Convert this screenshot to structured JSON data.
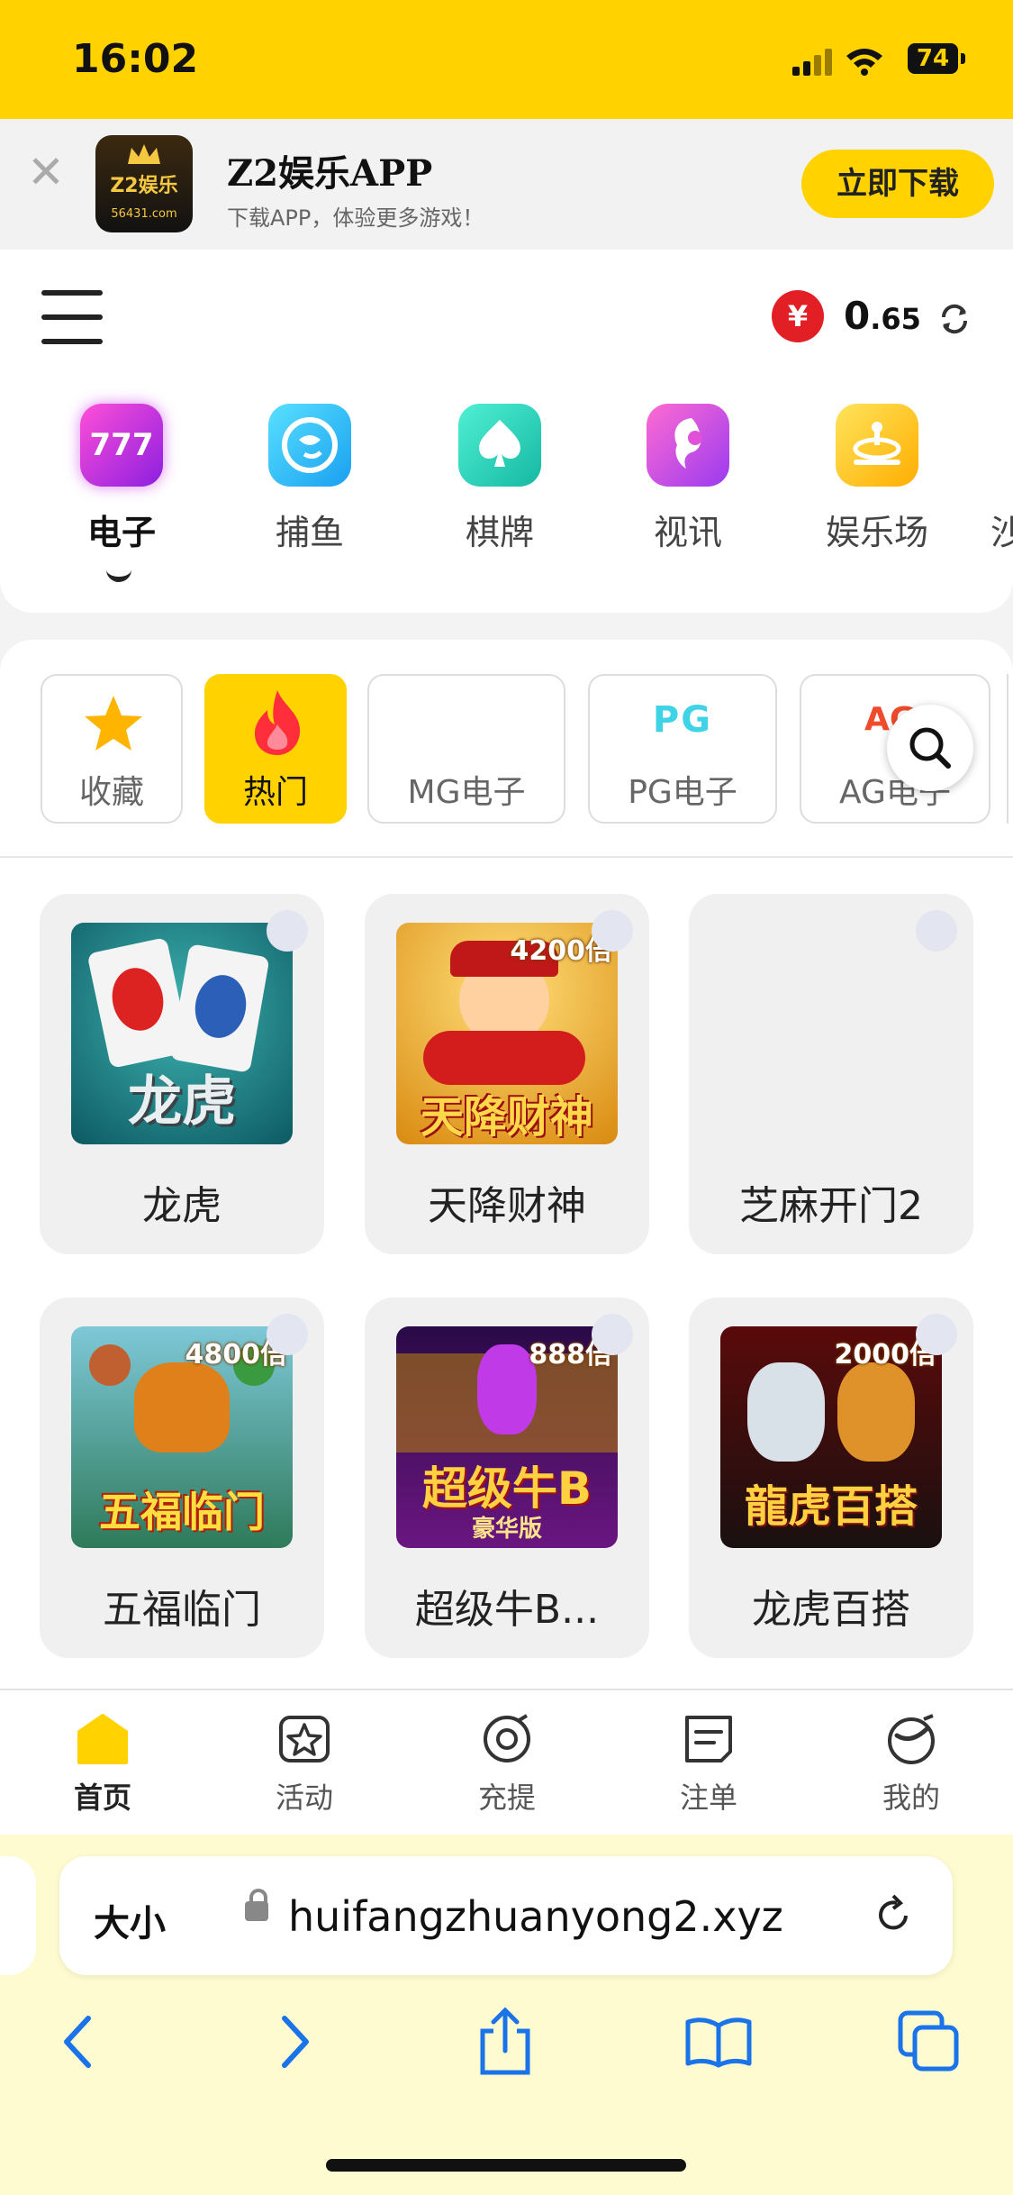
{
  "status": {
    "time": "16:02",
    "battery": "74"
  },
  "banner": {
    "app_name": "Z2娱乐APP",
    "subtitle": "下载APP，体验更多游戏！",
    "button": "立即下载",
    "logo_text": "Z2娱乐",
    "logo_url": "56431.com"
  },
  "header": {
    "currency_symbol": "¥",
    "balance_main": "0",
    "balance_decimal": ".65"
  },
  "categories": [
    {
      "label": "电子",
      "icon": "777-icon",
      "active": true
    },
    {
      "label": "捕鱼",
      "icon": "fish-icon"
    },
    {
      "label": "棋牌",
      "icon": "spade-icon"
    },
    {
      "label": "视讯",
      "icon": "live-woman-icon"
    },
    {
      "label": "娱乐场",
      "icon": "casino-icon"
    },
    {
      "label": "沙",
      "icon": "partial-icon"
    }
  ],
  "filters": [
    {
      "label": "收藏",
      "icon": "star-icon"
    },
    {
      "label": "热门",
      "icon": "fire-icon",
      "active": true
    },
    {
      "label": "MG电子",
      "icon": ""
    },
    {
      "label": "PG电子",
      "icon": "pg-logo-icon",
      "logo_text": "PG"
    },
    {
      "label": "AG电子",
      "icon": "ag-logo-icon",
      "logo_text": "AG"
    }
  ],
  "games": [
    {
      "name": "龙虎",
      "thumb_text": "龙虎"
    },
    {
      "name": "天降财神",
      "thumb_text": "天降财神",
      "multiplier": "4200倍"
    },
    {
      "name": "芝麻开门2"
    },
    {
      "name": "五福临门",
      "thumb_text": "五福临门",
      "multiplier": "4800倍"
    },
    {
      "name": "超级牛B...",
      "thumb_text": "超级牛B",
      "thumb_sub": "豪华版",
      "multiplier": "888倍"
    },
    {
      "name": "龙虎百搭",
      "thumb_text": "龍虎百搭",
      "multiplier": "2000倍"
    }
  ],
  "tabs": [
    {
      "label": "首页",
      "icon": "home-icon",
      "active": true
    },
    {
      "label": "活动",
      "icon": "activity-star-icon"
    },
    {
      "label": "充提",
      "icon": "deposit-icon"
    },
    {
      "label": "注单",
      "icon": "bet-slip-icon"
    },
    {
      "label": "我的",
      "icon": "profile-icon"
    }
  ],
  "browser": {
    "text_size": "大小",
    "url": "huifangzhuanyong2.xyz"
  },
  "colors": {
    "brand_yellow": "#ffd200",
    "coin_red": "#e31f26"
  }
}
